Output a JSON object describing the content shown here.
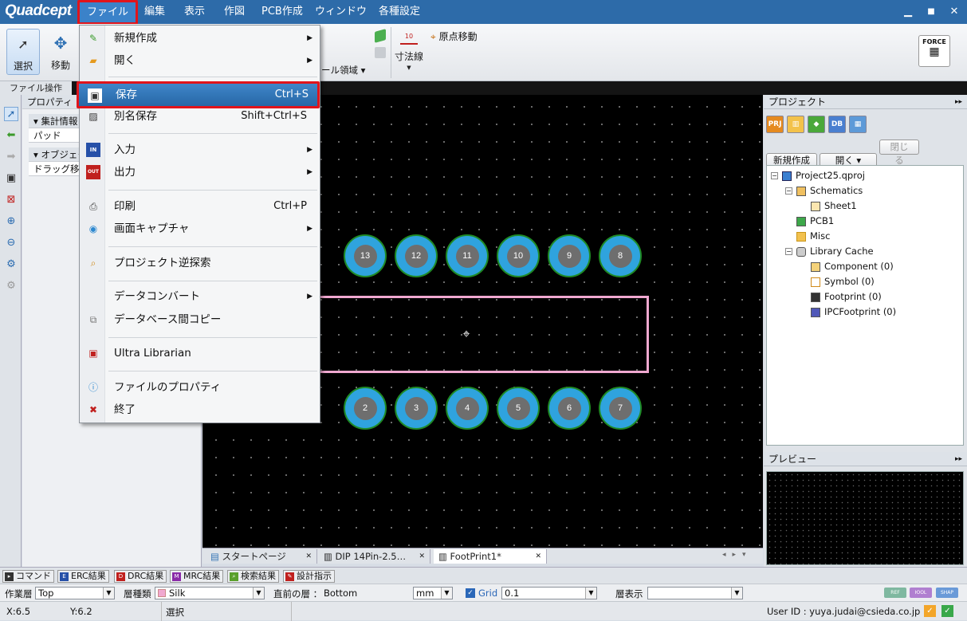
{
  "app": {
    "logo": "Quadcept"
  },
  "menubar": [
    "ファイル",
    "編集",
    "表示",
    "作図",
    "PCB作成",
    "ウィンドウ",
    "各種設定"
  ],
  "window_controls": {
    "minimize": "▁",
    "maximize": "■",
    "close": "✕"
  },
  "ribbon": {
    "select_label": "選択",
    "move_label": "移動",
    "area_label": "ール領域 ▾",
    "dimension_label": "寸法線",
    "dimension_icon_text": "10",
    "origin_move_label": "原点移動",
    "force_label": "FORCE",
    "group_label": "ファイル操作"
  },
  "file_menu": {
    "items": [
      {
        "icon": "new-file-icon",
        "label": "新規作成",
        "shortcut": "",
        "submenu": true
      },
      {
        "icon": "open-folder-icon",
        "label": "開く",
        "shortcut": "",
        "submenu": true
      },
      {
        "icon": "save-disk-icon",
        "label": "保存",
        "shortcut": "Ctrl+S",
        "submenu": false,
        "highlighted": true
      },
      {
        "icon": "save-as-icon",
        "label": "別名保存",
        "shortcut": "Shift+Ctrl+S",
        "submenu": false
      },
      {
        "icon": "import-in-icon",
        "label": "入力",
        "shortcut": "",
        "submenu": true,
        "badge": "IN"
      },
      {
        "icon": "export-out-icon",
        "label": "出力",
        "shortcut": "",
        "submenu": true,
        "badge": "OUT"
      },
      {
        "icon": "printer-icon",
        "label": "印刷",
        "shortcut": "Ctrl+P",
        "submenu": false
      },
      {
        "icon": "camera-icon",
        "label": "画面キャプチャ",
        "shortcut": "",
        "submenu": true
      },
      {
        "icon": "project-search-icon",
        "label": "プロジェクト逆探索",
        "shortcut": "",
        "submenu": false
      },
      {
        "icon": "data-convert-icon",
        "label": "データコンバート",
        "shortcut": "",
        "submenu": true
      },
      {
        "icon": "db-copy-icon",
        "label": "データベース間コピー",
        "shortcut": "",
        "submenu": false
      },
      {
        "icon": "ultra-librarian-icon",
        "label": "Ultra Librarian",
        "shortcut": "",
        "submenu": false
      },
      {
        "icon": "info-icon",
        "label": "ファイルのプロパティ",
        "shortcut": "",
        "submenu": false
      },
      {
        "icon": "exit-x-icon",
        "label": "終了",
        "shortcut": "",
        "submenu": false
      }
    ]
  },
  "properties": {
    "title": "プロパティ",
    "summary_section": "集計情報",
    "pad_row": "パッド",
    "object_section": "オブジェク",
    "drag_row": "ドラッグ移"
  },
  "canvas": {
    "top_pads": [
      "13",
      "12",
      "11",
      "10",
      "9",
      "8"
    ],
    "bottom_pads": [
      "2",
      "3",
      "4",
      "5",
      "6",
      "7"
    ]
  },
  "doc_tabs": [
    {
      "icon": "page-icon",
      "label": "スタートページ",
      "close": "✕"
    },
    {
      "icon": "chip-icon",
      "label": "DIP 14Pin-2.5…",
      "close": "✕"
    },
    {
      "icon": "chip-icon",
      "label": "FootPrint1*",
      "close": "✕",
      "active": true
    }
  ],
  "project_panel": {
    "title": "プロジェクト",
    "toolbar_icons": [
      "PRJ",
      "book",
      "layers",
      "DB",
      "grid"
    ],
    "new_button": "新規作成",
    "open_button": "開く ▾",
    "close_button": "閉じる",
    "tree": [
      {
        "level": 0,
        "expander": "−",
        "icon": "project-icon",
        "label": "Project25.qproj"
      },
      {
        "level": 1,
        "expander": "−",
        "icon": "schematics-folder-icon",
        "label": "Schematics"
      },
      {
        "level": 2,
        "expander": "",
        "icon": "sheet-icon",
        "label": "Sheet1"
      },
      {
        "level": 1,
        "expander": "",
        "icon": "pcb-icon",
        "label": "PCB1"
      },
      {
        "level": 1,
        "expander": "",
        "icon": "folder-icon",
        "label": "Misc"
      },
      {
        "level": 1,
        "expander": "−",
        "icon": "library-cache-icon",
        "label": "Library Cache"
      },
      {
        "level": 2,
        "expander": "",
        "icon": "component-icon",
        "label": "Component (0)"
      },
      {
        "level": 2,
        "expander": "",
        "icon": "symbol-icon",
        "label": "Symbol (0)"
      },
      {
        "level": 2,
        "expander": "",
        "icon": "footprint-icon",
        "label": "Footprint (0)"
      },
      {
        "level": 2,
        "expander": "",
        "icon": "ipc-footprint-icon",
        "label": "IPCFootprint (0)"
      }
    ],
    "preview_title": "プレビュー"
  },
  "bottom_tabs": [
    {
      "label": "コマンド",
      "color": "#333333"
    },
    {
      "label": "ERC結果",
      "color": "#2650a8"
    },
    {
      "label": "DRC結果",
      "color": "#c0201e"
    },
    {
      "label": "MRC結果",
      "color": "#8a2aa8"
    },
    {
      "label": "検索結果",
      "color": "#5aa02c"
    },
    {
      "label": "設計指示",
      "color": "#c0201e"
    }
  ],
  "layer_bar": {
    "work_layer_label": "作業層",
    "work_layer_value": "Top",
    "layer_type_label": "層種類",
    "layer_type_value": "Silk",
    "prev_layer_label": "直前の層 ：",
    "prev_layer_value": "Bottom",
    "unit_value": "mm",
    "grid_label": "Grid",
    "grid_value": "0.1",
    "layer_display_label": "層表示",
    "layer_display_value": "",
    "mini_buttons": [
      "REF",
      "ЮOL",
      "SHAP"
    ]
  },
  "status": {
    "x": "X:6.5",
    "y": "Y:6.2",
    "mode": "選択",
    "user": "User ID : yuya.judai@csieda.co.jp"
  }
}
